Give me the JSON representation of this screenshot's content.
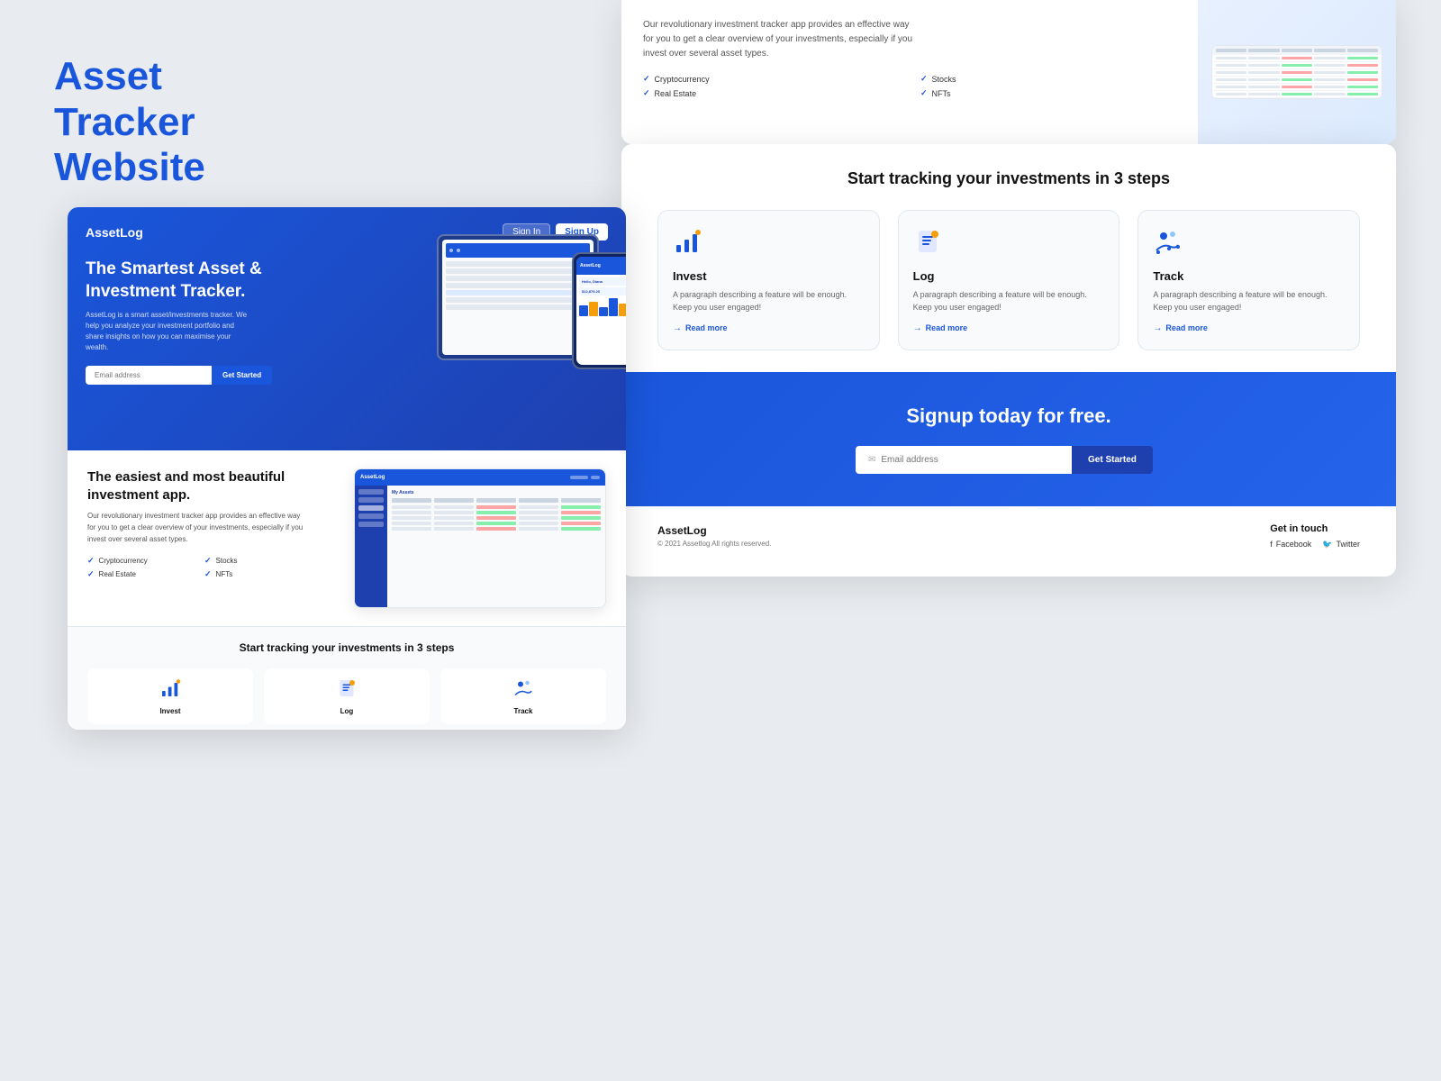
{
  "page": {
    "title": "Asset Tracker Website"
  },
  "left_label": {
    "line1": "Asset Tracker",
    "line2": "Website"
  },
  "hero": {
    "logo": "AssetLog",
    "signin": "Sign In",
    "signup": "Sign Up",
    "title": "The Smartest Asset & Investment Tracker.",
    "desc": "AssetLog is a smart asset/investments tracker. We help you analyze your investment portfolio and share insights on how you can maximise your wealth.",
    "email_placeholder": "Email address",
    "cta": "Get Started"
  },
  "content_section": {
    "title": "The easiest and most beautiful investment app.",
    "desc": "Our revolutionary investment tracker app provides an effective way for you to get a clear overview of your investments, especially if you invest over several asset types.",
    "features": [
      "Cryptocurrency",
      "Stocks",
      "Real Estate",
      "NFTs"
    ]
  },
  "steps_section": {
    "title": "Start tracking your investments in 3 steps",
    "steps": [
      {
        "name": "Invest",
        "icon": "📊",
        "desc": "A paragraph describing a feature will be enough. Keep you user engaged!",
        "read_more": "Read more"
      },
      {
        "name": "Log",
        "icon": "📋",
        "desc": "A paragraph describing a feature will be enough. Keep you user engaged!",
        "read_more": "Read more"
      },
      {
        "name": "Track",
        "icon": "👥",
        "desc": "A paragraph describing a feature will be enough. Keep you user engaged!",
        "read_more": "Read more"
      }
    ]
  },
  "signup_banner": {
    "title": "Signup today for free.",
    "email_placeholder": "Email address",
    "cta": "Get Started"
  },
  "footer": {
    "logo": "AssetLog",
    "copyright": "© 2021 Assetlog All rights reserved.",
    "get_in_touch": "Get in touch",
    "links": [
      {
        "icon": "f",
        "label": "Facebook"
      },
      {
        "icon": "t",
        "label": "Twitter"
      }
    ]
  },
  "right_top": {
    "desc": "Our revolutionary investment tracker app provides an effective way for you to get a clear overview of your investments, especially if you invest over several asset types.",
    "features": [
      "Cryptocurrency",
      "Stocks",
      "Real Estate",
      "NFTs"
    ]
  }
}
